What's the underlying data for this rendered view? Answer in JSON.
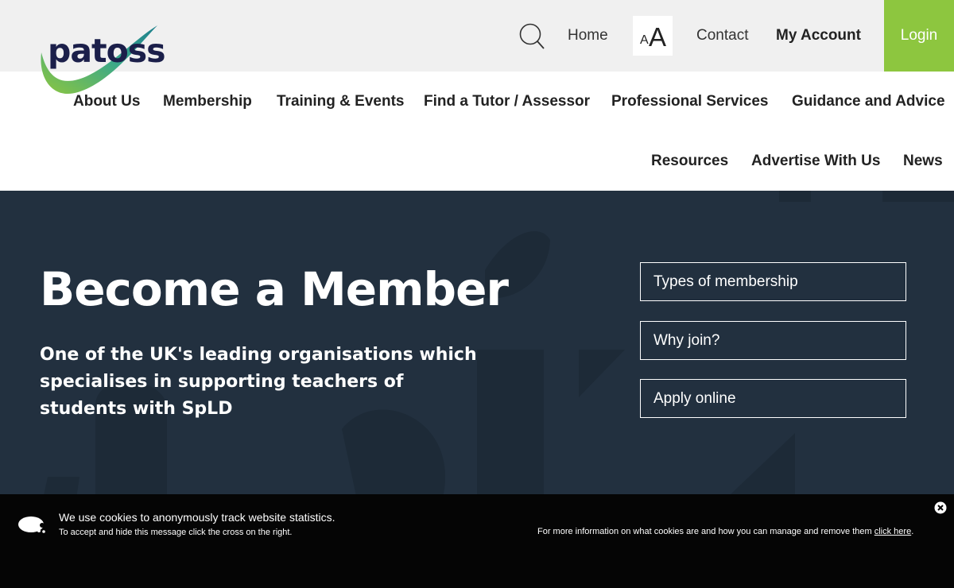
{
  "logo": {
    "text": "patoss"
  },
  "utility": {
    "search_icon": "search-icon",
    "home": "Home",
    "font_small": "A",
    "font_large": "A",
    "contact": "Contact",
    "account": "My Account",
    "login": "Login"
  },
  "nav": {
    "items": [
      "About Us",
      "Membership",
      "Training & Events",
      "Find a Tutor / Assessor",
      "Professional Services",
      "Guidance and Advice",
      "Resources",
      "Advertise With Us",
      "News"
    ]
  },
  "hero": {
    "title": "Become a Member",
    "subtitle": "One of the UK's leading organisations which specialises in supporting teachers of students with SpLD",
    "buttons": [
      "Types of membership",
      "Why join?",
      "Apply online"
    ]
  },
  "cookie": {
    "main": "We use cookies to anonymously track website statistics.",
    "sub": "To accept and hide this message click the cross on the right.",
    "info_prefix": "For more information on what cookies are and how you can manage and remove them ",
    "info_link": "click here",
    "info_suffix": "."
  },
  "colors": {
    "topbar_bg": "#f0f0f0",
    "login_green": "#8dc63f",
    "hero_bg": "#22303f",
    "logo_navy": "#1b1f4a",
    "cookie_bg": "#050505"
  }
}
